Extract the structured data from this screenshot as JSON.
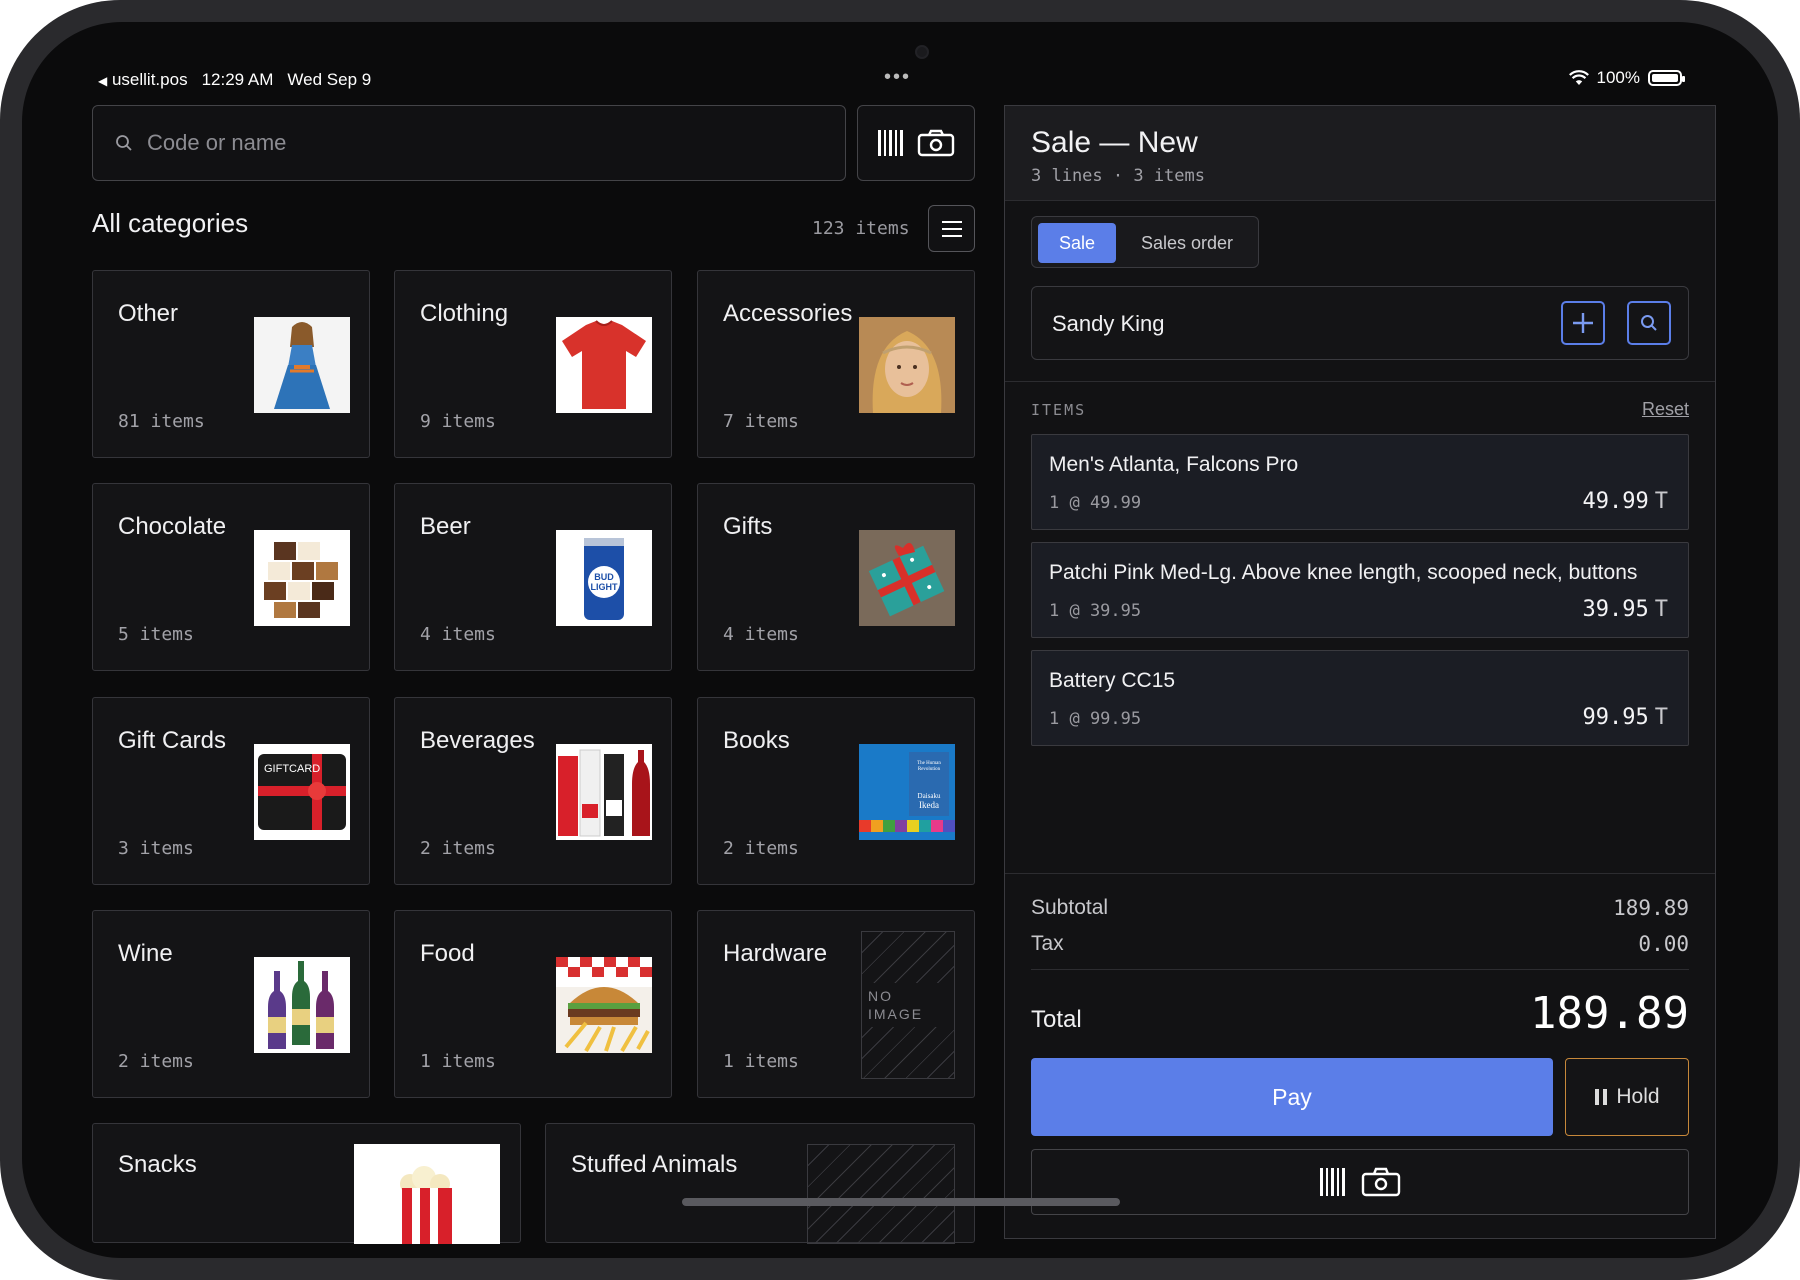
{
  "status_bar": {
    "back_app": "usellit.pos",
    "time": "12:29 AM",
    "date": "Wed Sep 9",
    "battery": "100%"
  },
  "search": {
    "placeholder": "Code or name"
  },
  "categories": {
    "title": "All categories",
    "count": "123 items",
    "tiles": [
      {
        "name": "Other",
        "count": "81 items",
        "icon": "dress-photo"
      },
      {
        "name": "Clothing",
        "count": "9 items",
        "icon": "tshirt-photo"
      },
      {
        "name": "Accessories",
        "count": "7 items",
        "icon": "headband-photo"
      },
      {
        "name": "Chocolate",
        "count": "5 items",
        "icon": "chocolate-photo"
      },
      {
        "name": "Beer",
        "count": "4 items",
        "icon": "beer-can-photo"
      },
      {
        "name": "Gifts",
        "count": "4 items",
        "icon": "gift-box-photo"
      },
      {
        "name": "Gift Cards",
        "count": "3 items",
        "icon": "gift-card-photo"
      },
      {
        "name": "Beverages",
        "count": "2 items",
        "icon": "bottles-photo"
      },
      {
        "name": "Books",
        "count": "2 items",
        "icon": "book-photo"
      },
      {
        "name": "Wine",
        "count": "2 items",
        "icon": "wine-photo"
      },
      {
        "name": "Food",
        "count": "1 items",
        "icon": "burger-photo"
      },
      {
        "name": "Hardware",
        "count": "1 items",
        "icon": "no-image"
      },
      {
        "name": "Snacks",
        "count": "",
        "icon": "popcorn-photo"
      },
      {
        "name": "Stuffed Animals",
        "count": "",
        "icon": "no-image"
      }
    ],
    "no_image_label": "NO IMAGE",
    "book_cover_text": "The Human Revolution Daisaku Ikeda",
    "gift_card_text": "GIFTCARD",
    "beer_can_text": "BUD LIGHT"
  },
  "sale": {
    "title": "Sale — New",
    "subtitle": "3 lines · 3 items",
    "mode_sale": "Sale",
    "mode_order": "Sales order",
    "customer": "Sandy King",
    "items_label": "ITEMS",
    "reset_label": "Reset",
    "lines": [
      {
        "name": "Men's Atlanta, Falcons Pro",
        "qty": "1 @ 49.99",
        "price": "49.99",
        "tax": "T"
      },
      {
        "name": "Patchi Pink Med-Lg. Above knee length, scooped neck, buttons",
        "qty": "1 @ 39.95",
        "price": "39.95",
        "tax": "T"
      },
      {
        "name": "Battery CC15",
        "qty": "1 @ 99.95",
        "price": "99.95",
        "tax": "T"
      }
    ],
    "subtotal_label": "Subtotal",
    "subtotal": "189.89",
    "tax_label": "Tax",
    "tax": "0.00",
    "total_label": "Total",
    "total": "189.89",
    "pay_label": "Pay",
    "hold_label": "Hold"
  },
  "colors": {
    "accent": "#5b7ee8",
    "hold_border": "#c7883a",
    "background": "#0b0b0c"
  }
}
